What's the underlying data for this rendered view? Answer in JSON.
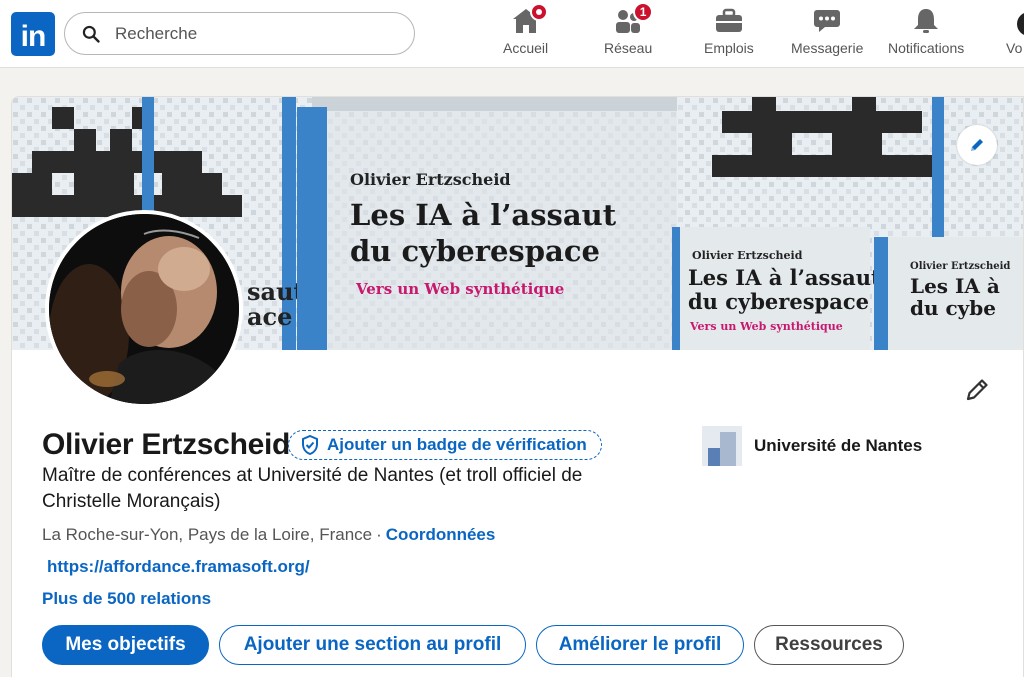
{
  "nav": {
    "logo_text": "in",
    "search_placeholder": "Recherche",
    "items": [
      {
        "label": "Accueil",
        "icon": "home-icon",
        "badge": "dot"
      },
      {
        "label": "Réseau",
        "icon": "network-icon",
        "badge": "1"
      },
      {
        "label": "Emplois",
        "icon": "briefcase-icon"
      },
      {
        "label": "Messagerie",
        "icon": "messaging-icon"
      },
      {
        "label": "Notifications",
        "icon": "bell-icon"
      }
    ],
    "me_label": "Vo"
  },
  "banner": {
    "author": "Olivier Ertzscheid",
    "book_title_line1": "Les IA à l’assaut",
    "book_title_line2": "du cyberespace",
    "book_subtitle": "Vers un Web synthétique",
    "side_text_1": "saut",
    "side_text_2": "ace",
    "right_author": "Olivier Ertzscheid",
    "right_title_1": "Les IA à l’assaut",
    "right_title_2": "du cyberespace",
    "right_subtitle": "Vers un Web synthétique",
    "far_right_1": "Olivier Ertzscheid",
    "far_right_2": "Les IA à",
    "far_right_3": "du cybe"
  },
  "profile": {
    "name": "Olivier Ertzscheid",
    "verify_badge_label": "Ajouter un badge de vérification",
    "headline": "Maître de conférences at Université de Nantes (et troll officiel de Christelle Morançais)",
    "location": "La Roche-sur-Yon, Pays de la Loire, France",
    "separator": "·",
    "contact_label": "Coordonnées",
    "website": "https://affordance.framasoft.org/",
    "relations": "Plus de 500 relations",
    "education": "Université de Nantes"
  },
  "actions": {
    "goals": "Mes objectifs",
    "add_section": "Ajouter une section au profil",
    "improve": "Améliorer le profil",
    "resources": "Ressources"
  },
  "colors": {
    "brand": "#0a66c2",
    "notification": "#cb112d"
  }
}
